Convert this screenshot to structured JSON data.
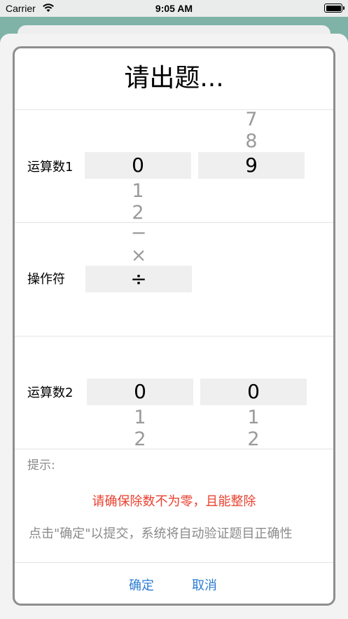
{
  "status_bar": {
    "carrier": "Carrier",
    "time": "9:05 AM"
  },
  "dialog": {
    "title": "请出题...",
    "operand1": {
      "label": "运算数1",
      "col_tens": {
        "selected": "0",
        "below": [
          "1",
          "2"
        ]
      },
      "col_units": {
        "above": [
          "7",
          "8"
        ],
        "selected": "9"
      }
    },
    "operator": {
      "label": "操作符",
      "above": [
        "−",
        "×"
      ],
      "selected": "÷"
    },
    "operand2": {
      "label": "运算数2",
      "col_tens": {
        "selected": "0",
        "below": [
          "1",
          "2"
        ]
      },
      "col_units": {
        "selected": "0",
        "below": [
          "1",
          "2"
        ]
      }
    },
    "hint_label": "提示:",
    "warning": "请确保除数不为零，且能整除",
    "instruction": "点击\"确定\"以提交，系统将自动验证题目正确性",
    "confirm_label": "确定",
    "cancel_label": "取消"
  },
  "colors": {
    "accent": "#2b7cd3",
    "warning": "#e8412f",
    "hint": "#8a8a8a"
  }
}
